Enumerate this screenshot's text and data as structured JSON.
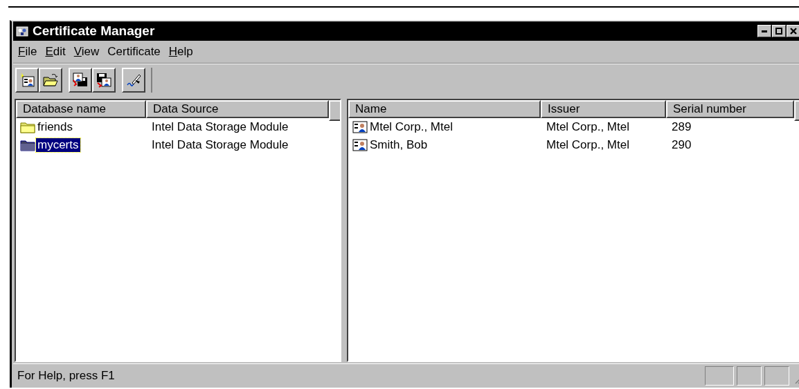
{
  "window": {
    "title": "Certificate Manager"
  },
  "menu": [
    {
      "label": "File",
      "underlined": true
    },
    {
      "label": "Edit",
      "underlined": true
    },
    {
      "label": "View",
      "underlined": true
    },
    {
      "label": "Certificate",
      "underlined": false
    },
    {
      "label": "Help",
      "underlined": true
    }
  ],
  "toolbar": [
    {
      "kind": "new-certificate"
    },
    {
      "kind": "open-folder"
    },
    {
      "kind": "gap"
    },
    {
      "kind": "import"
    },
    {
      "kind": "export"
    },
    {
      "kind": "gap"
    },
    {
      "kind": "sign"
    }
  ],
  "databases": {
    "columns": [
      "Database name",
      "Data Source"
    ],
    "rows": [
      {
        "cells": [
          "friends",
          "Intel Data Storage Module"
        ],
        "selected": false
      },
      {
        "cells": [
          "mycerts",
          "Intel Data Storage Module"
        ],
        "selected": true
      }
    ]
  },
  "certificates": {
    "columns": [
      "Name",
      "Issuer",
      "Serial number"
    ],
    "rows": [
      {
        "cells": [
          "Mtel Corp., Mtel",
          "Mtel Corp., Mtel",
          "289"
        ],
        "selected": false
      },
      {
        "cells": [
          "Smith, Bob",
          "Mtel Corp., Mtel",
          "290"
        ],
        "selected": false
      }
    ]
  },
  "status_bar": {
    "text": "For Help, press F1"
  }
}
